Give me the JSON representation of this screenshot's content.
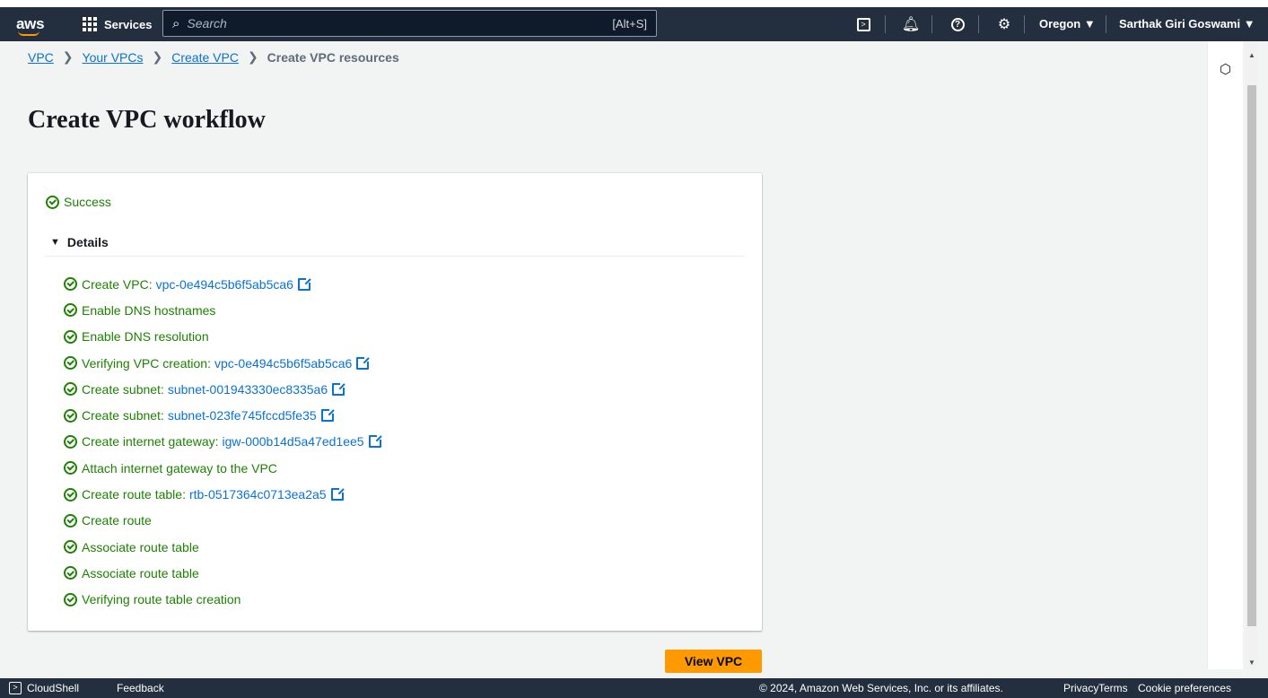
{
  "nav": {
    "logo": "aws",
    "services_label": "Services",
    "search_placeholder": "Search",
    "search_shortcut": "[Alt+S]",
    "region": "Oregon ▼",
    "user": "Sarthak Giri Goswami ▼",
    "icons": [
      "cloudshell-icon",
      "bell-icon",
      "help-icon",
      "settings-icon"
    ]
  },
  "breadcrumb": {
    "items": [
      "VPC",
      "Your VPCs",
      "Create VPC"
    ],
    "current": "Create VPC resources"
  },
  "page": {
    "title": "Create VPC workflow"
  },
  "card": {
    "status": "Success",
    "details_label": "Details",
    "steps": [
      {
        "label": "Create VPC:",
        "link": "vpc-0e494c5b6f5ab5ca6"
      },
      {
        "label": "Enable DNS hostnames",
        "link": ""
      },
      {
        "label": "Enable DNS resolution",
        "link": ""
      },
      {
        "label": "Verifying VPC creation:",
        "link": "vpc-0e494c5b6f5ab5ca6"
      },
      {
        "label": "Create subnet:",
        "link": "subnet-001943330ec8335a6"
      },
      {
        "label": "Create subnet:",
        "link": "subnet-023fe745fccd5fe35"
      },
      {
        "label": "Create internet gateway:",
        "link": "igw-000b14d5a47ed1ee5"
      },
      {
        "label": "Attach internet gateway to the VPC",
        "link": ""
      },
      {
        "label": "Create route table:",
        "link": "rtb-0517364c0713ea2a5"
      },
      {
        "label": "Create route",
        "link": ""
      },
      {
        "label": "Associate route table",
        "link": ""
      },
      {
        "label": "Associate route table",
        "link": ""
      },
      {
        "label": "Verifying route table creation",
        "link": ""
      }
    ]
  },
  "actions": {
    "view_vpc": "View VPC"
  },
  "footer": {
    "cloudshell": "CloudShell",
    "feedback": "Feedback",
    "copyright": "© 2024, Amazon Web Services, Inc. or its affiliates.",
    "privacy": "Privacy",
    "terms": "Terms",
    "cookie": "Cookie preferences"
  },
  "colors": {
    "nav_bg": "#232f3e",
    "success": "#1d8102",
    "link": "#0972d3",
    "primary_button": "#ff9900"
  }
}
